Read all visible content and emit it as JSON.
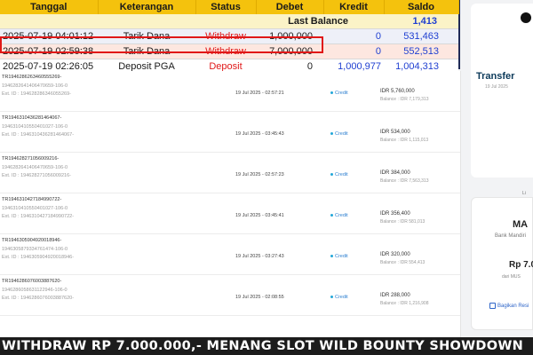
{
  "ledger": {
    "headers": [
      "Tanggal",
      "Keterangan",
      "Status",
      "Debet",
      "Kredit",
      "Saldo"
    ],
    "last_balance_label": "Last Balance",
    "last_balance_value": "1,413",
    "rows": [
      {
        "date": "2025-07-19 04:01:12",
        "desc": "Tarik Dana",
        "status": "Withdraw",
        "debet": "1,000,000",
        "kredit": "0",
        "saldo": "531,463"
      },
      {
        "date": "2025-07-19 02:59:38",
        "desc": "Tarik Dana",
        "status": "Withdraw",
        "debet": "7,000,000",
        "kredit": "0",
        "saldo": "552,513"
      },
      {
        "date": "2025-07-19 02:26:05",
        "desc": "Deposit PGA",
        "status": "Deposit",
        "debet": "0",
        "kredit": "1,000,977",
        "saldo": "1,004,313"
      }
    ]
  },
  "transactions": [
    {
      "id": "TR194628626346055526​9-",
      "sub1": "1946282641406470659-106-0",
      "sub2": "Ext. ID : 19462828634605526​9-",
      "date": "19 Jul 2025 - 02:57:21",
      "type": "Credit",
      "amount": "IDR 5,760,000",
      "balance": "Balance : IDR 7,179,313"
    },
    {
      "id": "TR1946310436281464067-",
      "sub1": "1946310410550401027-106-0",
      "sub2": "Ext. ID : 1946310436281464067-",
      "date": "19 Jul 2025 - 03:45:43",
      "type": "Credit",
      "amount": "IDR 534,000",
      "balance": "Balance : IDR 1,115,013"
    },
    {
      "id": "TR1946282710560092​16-",
      "sub1": "1946282641406470659-106-0",
      "sub2": "Ext. ID : 1946282710560092​16-",
      "date": "19 Jul 2025 - 02:57:23",
      "type": "Credit",
      "amount": "IDR 384,000",
      "balance": "Balance : IDR 7,563,313"
    },
    {
      "id": "TR1946310427184990722-",
      "sub1": "1946310410550401027-106-0",
      "sub2": "Ext. ID : 1946310427184990722-",
      "date": "19 Jul 2025 - 03:45:41",
      "type": "Credit",
      "amount": "IDR 356,400",
      "balance": "Balance : IDR 581,013"
    },
    {
      "id": "TR1946305904920018946-",
      "sub1": "1946305879334761474-106-0",
      "sub2": "Ext. ID : 1946305904920018946-",
      "date": "19 Jul 2025 - 03:27:43",
      "type": "Credit",
      "amount": "IDR 320,000",
      "balance": "Balance : IDR 554,413"
    },
    {
      "id": "TR1946286076003887620-",
      "sub1": "1946286058631122946-106-0",
      "sub2": "Ext. ID : 1946286076003887620-",
      "date": "19 Jul 2025 - 02:08:55",
      "type": "Credit",
      "amount": "IDR 288,000",
      "balance": "Balance : IDR 1,216,908"
    }
  ],
  "side": {
    "title": "Transfer",
    "date": "19 Jul 2025",
    "li": "Li",
    "bank_name": "MA",
    "bank_sub": "Bank Mandiri",
    "amount": "Rp 7.0",
    "ref": "dari MUS",
    "share": "Bagikan Resi"
  },
  "banner": {
    "text": "WITHDRAW RP 7.000.000,- MENANG SLOT WILD BOUNTY SHOWDOWN"
  },
  "colors": {
    "header_yellow": "#f4c20d",
    "withdraw_red": "#e01818",
    "kredit_blue": "#1f3fd1",
    "navy_border": "#1f2a57"
  }
}
